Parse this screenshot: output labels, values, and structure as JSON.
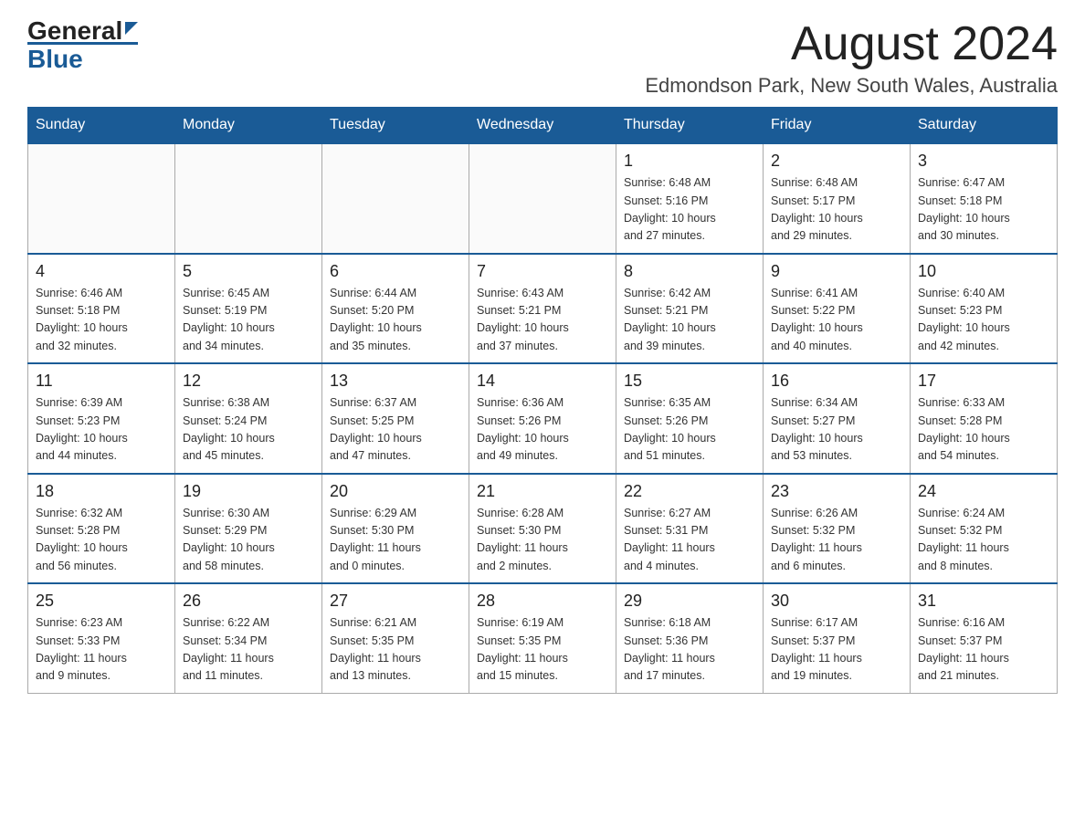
{
  "header": {
    "logo_general": "General",
    "logo_blue": "Blue",
    "month_title": "August 2024",
    "location": "Edmondson Park, New South Wales, Australia"
  },
  "days_of_week": [
    "Sunday",
    "Monday",
    "Tuesday",
    "Wednesday",
    "Thursday",
    "Friday",
    "Saturday"
  ],
  "weeks": [
    [
      {
        "day": "",
        "info": ""
      },
      {
        "day": "",
        "info": ""
      },
      {
        "day": "",
        "info": ""
      },
      {
        "day": "",
        "info": ""
      },
      {
        "day": "1",
        "info": "Sunrise: 6:48 AM\nSunset: 5:16 PM\nDaylight: 10 hours\nand 27 minutes."
      },
      {
        "day": "2",
        "info": "Sunrise: 6:48 AM\nSunset: 5:17 PM\nDaylight: 10 hours\nand 29 minutes."
      },
      {
        "day": "3",
        "info": "Sunrise: 6:47 AM\nSunset: 5:18 PM\nDaylight: 10 hours\nand 30 minutes."
      }
    ],
    [
      {
        "day": "4",
        "info": "Sunrise: 6:46 AM\nSunset: 5:18 PM\nDaylight: 10 hours\nand 32 minutes."
      },
      {
        "day": "5",
        "info": "Sunrise: 6:45 AM\nSunset: 5:19 PM\nDaylight: 10 hours\nand 34 minutes."
      },
      {
        "day": "6",
        "info": "Sunrise: 6:44 AM\nSunset: 5:20 PM\nDaylight: 10 hours\nand 35 minutes."
      },
      {
        "day": "7",
        "info": "Sunrise: 6:43 AM\nSunset: 5:21 PM\nDaylight: 10 hours\nand 37 minutes."
      },
      {
        "day": "8",
        "info": "Sunrise: 6:42 AM\nSunset: 5:21 PM\nDaylight: 10 hours\nand 39 minutes."
      },
      {
        "day": "9",
        "info": "Sunrise: 6:41 AM\nSunset: 5:22 PM\nDaylight: 10 hours\nand 40 minutes."
      },
      {
        "day": "10",
        "info": "Sunrise: 6:40 AM\nSunset: 5:23 PM\nDaylight: 10 hours\nand 42 minutes."
      }
    ],
    [
      {
        "day": "11",
        "info": "Sunrise: 6:39 AM\nSunset: 5:23 PM\nDaylight: 10 hours\nand 44 minutes."
      },
      {
        "day": "12",
        "info": "Sunrise: 6:38 AM\nSunset: 5:24 PM\nDaylight: 10 hours\nand 45 minutes."
      },
      {
        "day": "13",
        "info": "Sunrise: 6:37 AM\nSunset: 5:25 PM\nDaylight: 10 hours\nand 47 minutes."
      },
      {
        "day": "14",
        "info": "Sunrise: 6:36 AM\nSunset: 5:26 PM\nDaylight: 10 hours\nand 49 minutes."
      },
      {
        "day": "15",
        "info": "Sunrise: 6:35 AM\nSunset: 5:26 PM\nDaylight: 10 hours\nand 51 minutes."
      },
      {
        "day": "16",
        "info": "Sunrise: 6:34 AM\nSunset: 5:27 PM\nDaylight: 10 hours\nand 53 minutes."
      },
      {
        "day": "17",
        "info": "Sunrise: 6:33 AM\nSunset: 5:28 PM\nDaylight: 10 hours\nand 54 minutes."
      }
    ],
    [
      {
        "day": "18",
        "info": "Sunrise: 6:32 AM\nSunset: 5:28 PM\nDaylight: 10 hours\nand 56 minutes."
      },
      {
        "day": "19",
        "info": "Sunrise: 6:30 AM\nSunset: 5:29 PM\nDaylight: 10 hours\nand 58 minutes."
      },
      {
        "day": "20",
        "info": "Sunrise: 6:29 AM\nSunset: 5:30 PM\nDaylight: 11 hours\nand 0 minutes."
      },
      {
        "day": "21",
        "info": "Sunrise: 6:28 AM\nSunset: 5:30 PM\nDaylight: 11 hours\nand 2 minutes."
      },
      {
        "day": "22",
        "info": "Sunrise: 6:27 AM\nSunset: 5:31 PM\nDaylight: 11 hours\nand 4 minutes."
      },
      {
        "day": "23",
        "info": "Sunrise: 6:26 AM\nSunset: 5:32 PM\nDaylight: 11 hours\nand 6 minutes."
      },
      {
        "day": "24",
        "info": "Sunrise: 6:24 AM\nSunset: 5:32 PM\nDaylight: 11 hours\nand 8 minutes."
      }
    ],
    [
      {
        "day": "25",
        "info": "Sunrise: 6:23 AM\nSunset: 5:33 PM\nDaylight: 11 hours\nand 9 minutes."
      },
      {
        "day": "26",
        "info": "Sunrise: 6:22 AM\nSunset: 5:34 PM\nDaylight: 11 hours\nand 11 minutes."
      },
      {
        "day": "27",
        "info": "Sunrise: 6:21 AM\nSunset: 5:35 PM\nDaylight: 11 hours\nand 13 minutes."
      },
      {
        "day": "28",
        "info": "Sunrise: 6:19 AM\nSunset: 5:35 PM\nDaylight: 11 hours\nand 15 minutes."
      },
      {
        "day": "29",
        "info": "Sunrise: 6:18 AM\nSunset: 5:36 PM\nDaylight: 11 hours\nand 17 minutes."
      },
      {
        "day": "30",
        "info": "Sunrise: 6:17 AM\nSunset: 5:37 PM\nDaylight: 11 hours\nand 19 minutes."
      },
      {
        "day": "31",
        "info": "Sunrise: 6:16 AM\nSunset: 5:37 PM\nDaylight: 11 hours\nand 21 minutes."
      }
    ]
  ]
}
